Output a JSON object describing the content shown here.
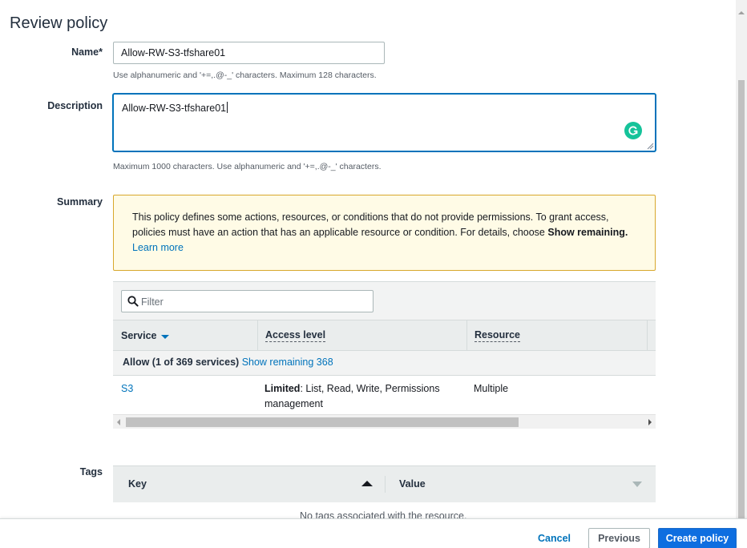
{
  "page": {
    "title": "Review policy"
  },
  "name_field": {
    "label": "Name*",
    "value": "Allow-RW-S3-tfshare01",
    "hint": "Use alphanumeric and '+=,.@-_' characters. Maximum 128 characters."
  },
  "description_field": {
    "label": "Description",
    "value": "Allow-RW-S3-tfshare01",
    "hint": "Maximum 1000 characters. Use alphanumeric and '+=,.@-_' characters."
  },
  "summary": {
    "label": "Summary",
    "warning": {
      "text": "This policy defines some actions, resources, or conditions that do not provide permissions. To grant access, policies must have an action that has an applicable resource or condition. For details, choose",
      "bold": "Show remaining.",
      "link": "Learn more"
    },
    "filter_placeholder": "Filter",
    "columns": [
      "Service",
      "Access level",
      "Resource"
    ],
    "group": {
      "label": "Allow (1 of 369 services)",
      "link": "Show remaining 368"
    },
    "rows": [
      {
        "service": "S3",
        "access_bold": "Limited",
        "access_rest": ": List, Read, Write, Permissions",
        "access_rest2": "management",
        "resource": "Multiple"
      }
    ]
  },
  "tags": {
    "label": "Tags",
    "key_header": "Key",
    "value_header": "Value",
    "empty": "No tags associated with the resource."
  },
  "footer": {
    "cancel": "Cancel",
    "previous": "Previous",
    "create": "Create policy"
  },
  "colors": {
    "accent": "#0073bb",
    "primary_button": "#0e6ee0",
    "warning_border": "#d8a72c",
    "warning_bg": "#fffbe6",
    "grammarly": "#15c39a"
  }
}
